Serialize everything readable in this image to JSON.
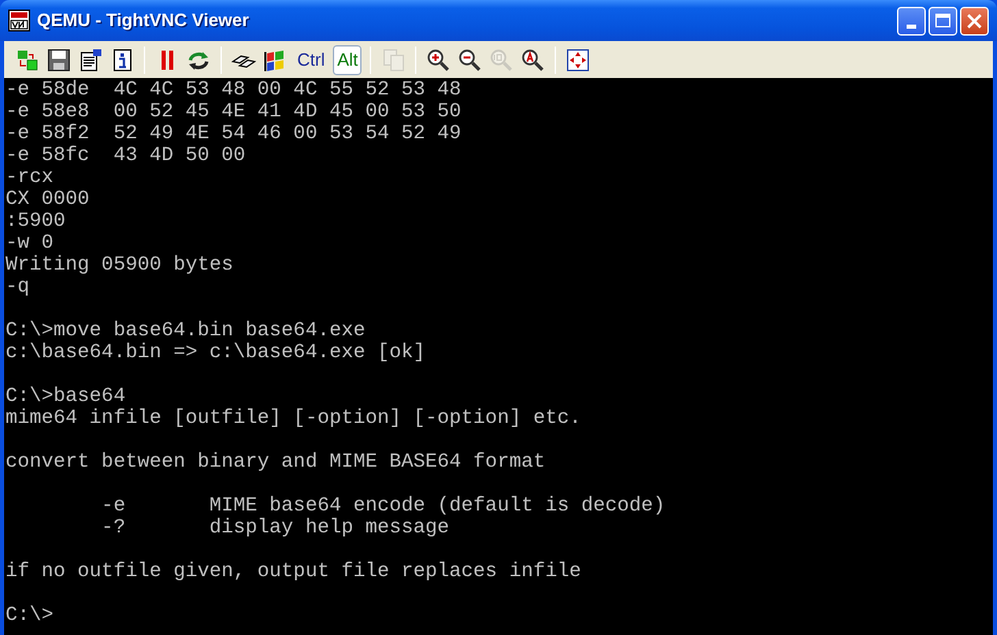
{
  "window": {
    "title": "QEMU - TightVNC Viewer"
  },
  "toolbar": [
    {
      "kind": "icon",
      "disabled": false
    },
    {
      "kind": "icon",
      "disabled": false
    },
    {
      "kind": "icon",
      "disabled": false
    },
    {
      "kind": "icon",
      "disabled": false
    },
    {
      "kind": "separator"
    },
    {
      "kind": "icon",
      "disabled": false
    },
    {
      "kind": "icon",
      "disabled": false
    },
    {
      "kind": "separator"
    },
    {
      "kind": "icon",
      "disabled": false
    },
    {
      "kind": "icon",
      "disabled": false
    },
    {
      "kind": "toggle",
      "label": "Ctrl",
      "selected": false
    },
    {
      "kind": "toggle",
      "label": "Alt",
      "selected": true
    },
    {
      "kind": "separator"
    },
    {
      "kind": "icon",
      "disabled": true
    },
    {
      "kind": "separator"
    },
    {
      "kind": "icon",
      "disabled": false
    },
    {
      "kind": "icon",
      "disabled": false
    },
    {
      "kind": "icon",
      "disabled": true
    },
    {
      "kind": "icon",
      "disabled": false
    },
    {
      "kind": "separator"
    },
    {
      "kind": "icon",
      "disabled": false
    }
  ],
  "console": {
    "lines": [
      {
        "kind": "text",
        "text": "-e 58de  4C 4C 53 48 00 4C 55 52 53 48"
      },
      {
        "kind": "text",
        "text": "-e 58e8  00 52 45 4E 41 4D 45 00 53 50"
      },
      {
        "kind": "text",
        "text": "-e 58f2  52 49 4E 54 46 00 53 54 52 49"
      },
      {
        "kind": "text",
        "text": "-e 58fc  43 4D 50 00"
      },
      {
        "kind": "text",
        "text": "-rcx"
      },
      {
        "kind": "text",
        "text": "CX 0000"
      },
      {
        "kind": "text",
        "text": ":5900"
      },
      {
        "kind": "text",
        "text": "-w 0"
      },
      {
        "kind": "text",
        "text": "Writing 05900 bytes"
      },
      {
        "kind": "text",
        "text": "-q"
      },
      {
        "kind": "blank"
      },
      {
        "kind": "text",
        "text": "C:\\>move base64.bin base64.exe"
      },
      {
        "kind": "text",
        "text": "c:\\base64.bin => c:\\base64.exe [ok]"
      },
      {
        "kind": "blank"
      },
      {
        "kind": "text",
        "text": "C:\\>base64"
      },
      {
        "kind": "text",
        "text": "mime64 infile [outfile] [-option] [-option] etc."
      },
      {
        "kind": "blank"
      },
      {
        "kind": "text",
        "text": "convert between binary and MIME BASE64 format"
      },
      {
        "kind": "blank"
      },
      {
        "kind": "text",
        "text": "        -e       MIME base64 encode (default is decode)"
      },
      {
        "kind": "text",
        "text": "        -?       display help message"
      },
      {
        "kind": "blank"
      },
      {
        "kind": "text",
        "text": "if no outfile given, output file replaces infile"
      },
      {
        "kind": "blank"
      },
      {
        "kind": "text",
        "text": "C:\\>"
      }
    ]
  }
}
